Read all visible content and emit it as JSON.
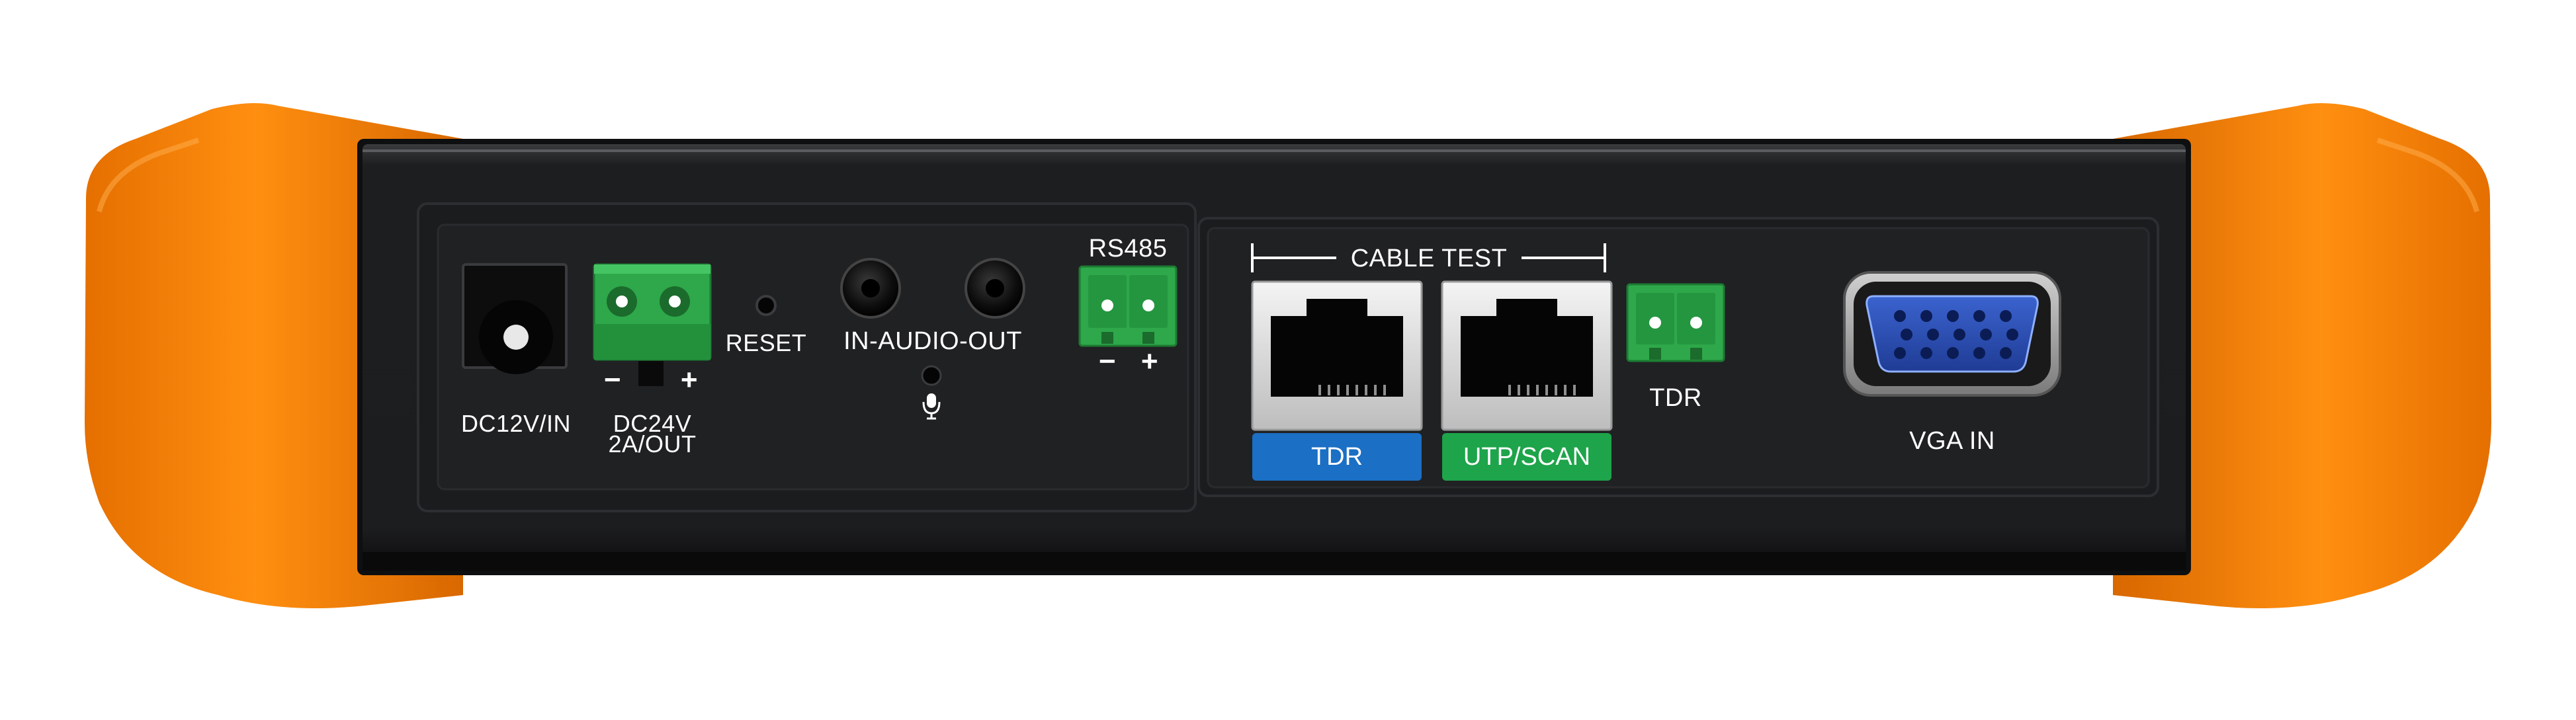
{
  "device": {
    "colors": {
      "bumper": "#f07d00",
      "body": "#232425",
      "terminal_green": "#2ea84a",
      "tdr_tag": "#1b6fc4",
      "utp_tag": "#1ea44a",
      "vga_blue": "#2d50b5"
    }
  },
  "left_panel": {
    "dc_in_label": "DC12V/IN",
    "dc_out_label_line1": "DC24V",
    "dc_out_label_line2": "2A/OUT",
    "dc_out_minus": "−",
    "dc_out_plus": "+",
    "reset_label": "RESET",
    "audio_label": "IN-AUDIO-OUT",
    "mic_icon": "microphone-icon",
    "rs485_label": "RS485",
    "rs485_minus": "−",
    "rs485_plus": "+"
  },
  "right_panel": {
    "cable_test_label": "CABLE TEST",
    "tdr_tag": "TDR",
    "utp_tag": "UTP/SCAN",
    "tdr_terminal_label": "TDR",
    "vga_label": "VGA IN"
  }
}
